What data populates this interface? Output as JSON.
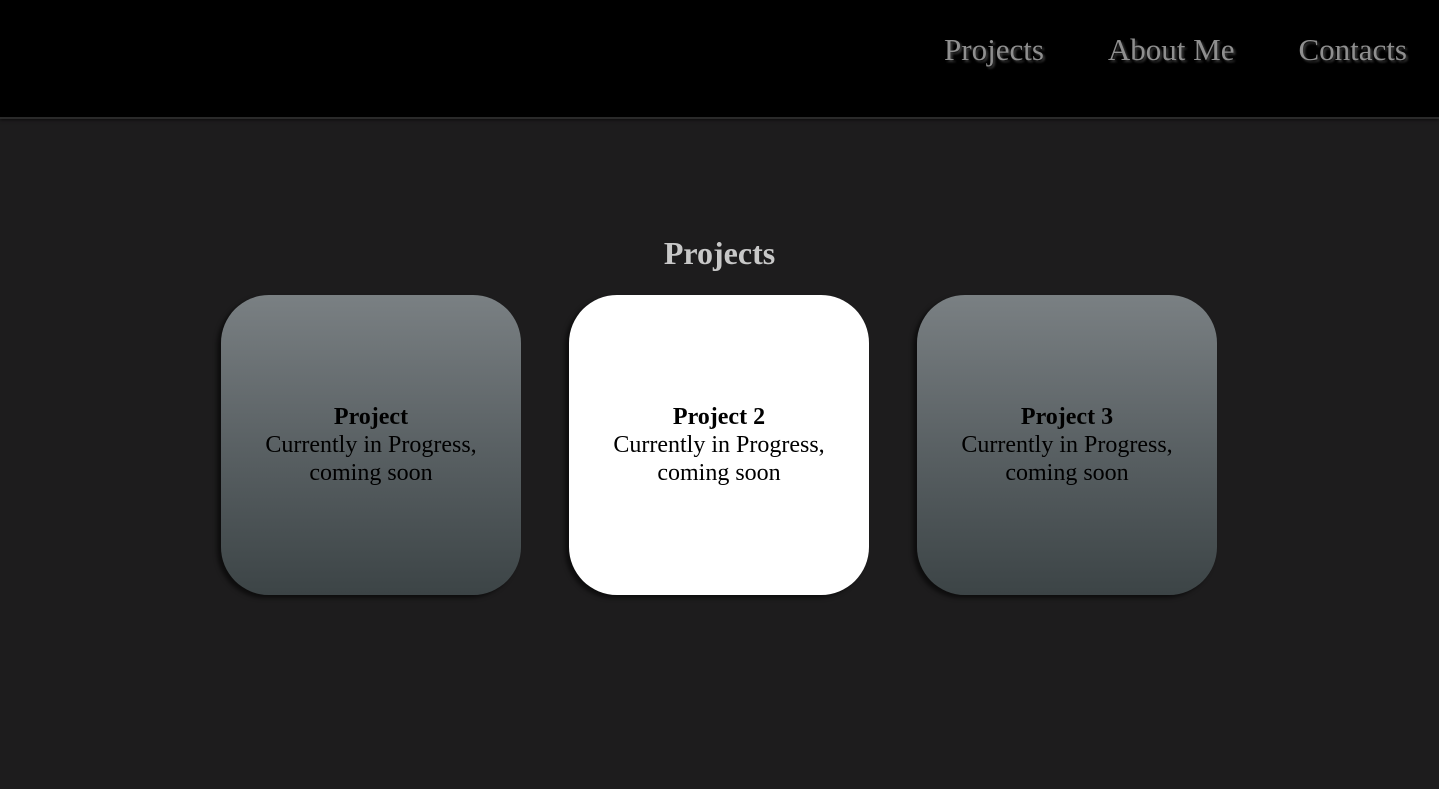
{
  "nav": {
    "items": [
      {
        "label": "Projects"
      },
      {
        "label": "About Me"
      },
      {
        "label": "Contacts"
      }
    ]
  },
  "main": {
    "title": "Projects",
    "cards": [
      {
        "title": "Project",
        "description": "Currently in Progress, coming soon",
        "highlighted": false
      },
      {
        "title": "Project 2",
        "description": "Currently in Progress, coming soon",
        "highlighted": true
      },
      {
        "title": "Project 3",
        "description": "Currently in Progress, coming soon",
        "highlighted": false
      }
    ]
  },
  "colors": {
    "header_bg": "#000000",
    "page_bg": "#1d1c1d",
    "nav_text": "#8f8f8f",
    "title_text": "#c8c8c8",
    "card_highlight": "#ffffff",
    "card_gradient_top": "#7a8083",
    "card_gradient_bottom": "#3c4446"
  }
}
